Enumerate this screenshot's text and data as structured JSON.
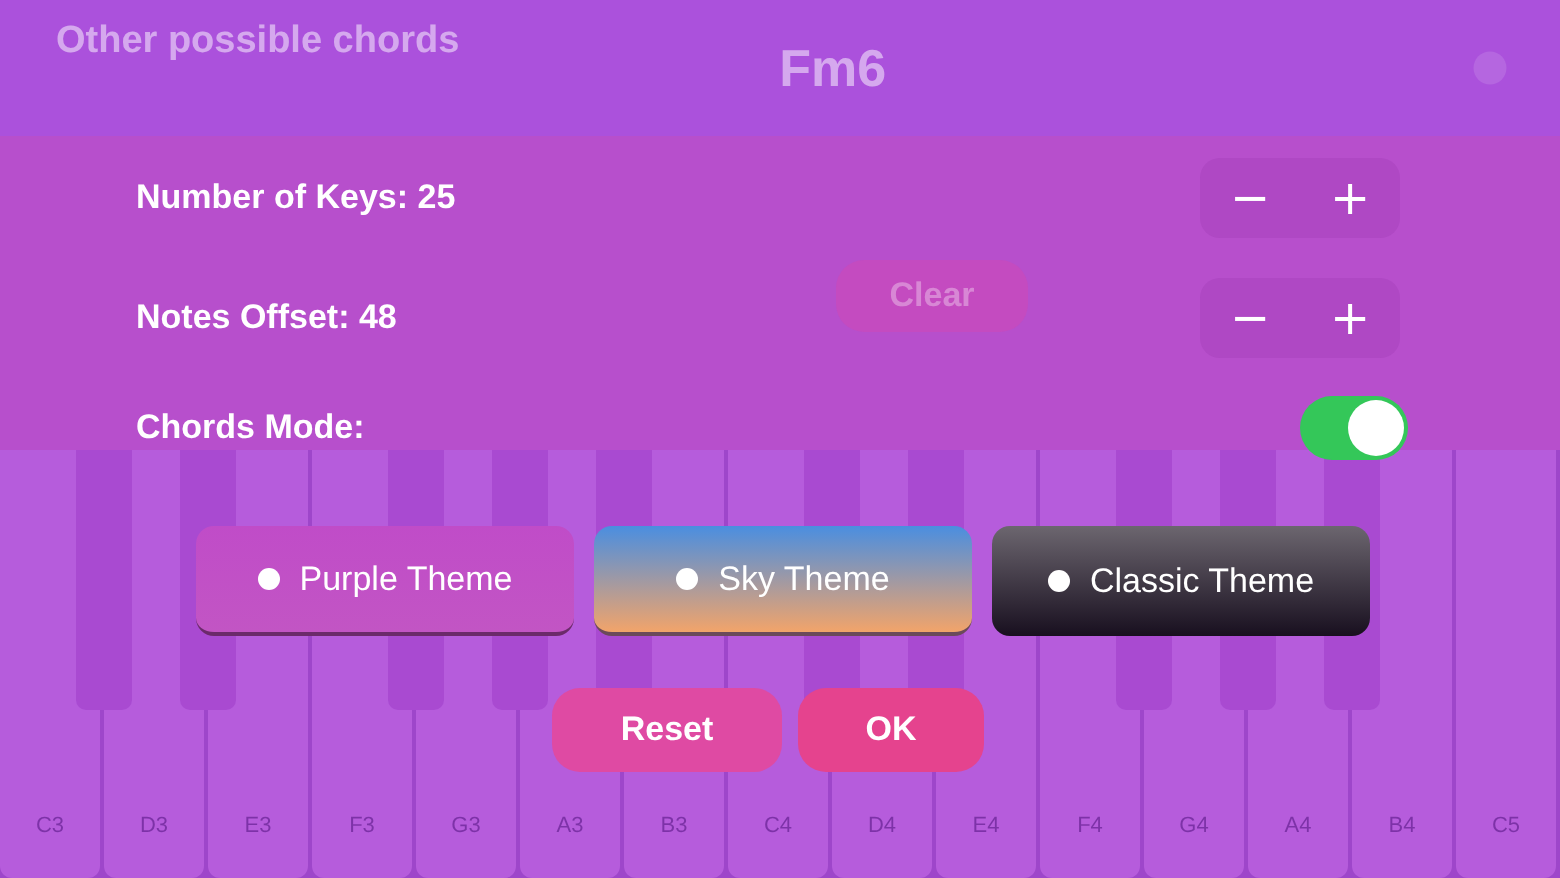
{
  "background": {
    "title": "Other possible chords",
    "chord": "Fm6",
    "clear_button": "Clear",
    "keys": [
      {
        "label": "C3"
      },
      {
        "label": "D3"
      },
      {
        "label": "E3"
      },
      {
        "label": "F3"
      },
      {
        "label": "G3"
      },
      {
        "label": "A3"
      },
      {
        "label": "B3"
      },
      {
        "label": "C4"
      },
      {
        "label": "D4"
      },
      {
        "label": "E4"
      },
      {
        "label": "F4"
      },
      {
        "label": "G4"
      },
      {
        "label": "A4"
      },
      {
        "label": "B4"
      },
      {
        "label": "C5"
      }
    ]
  },
  "settings": {
    "rows": [
      {
        "kind": "stepper",
        "label": "Number of Keys: 25",
        "minus": "−",
        "plus": "+"
      },
      {
        "kind": "stepper",
        "label": "Notes Offset: 48",
        "minus": "−",
        "plus": "+"
      },
      {
        "kind": "toggle",
        "label": "Chords Mode:",
        "on": true
      }
    ],
    "themes": [
      {
        "kind": "purple",
        "label": "Purple Theme"
      },
      {
        "kind": "sky",
        "label": "Sky Theme"
      },
      {
        "kind": "classic",
        "label": "Classic Theme"
      }
    ],
    "buttons": [
      {
        "kind": "reset",
        "label": "Reset"
      },
      {
        "kind": "ok",
        "label": "OK"
      }
    ]
  }
}
